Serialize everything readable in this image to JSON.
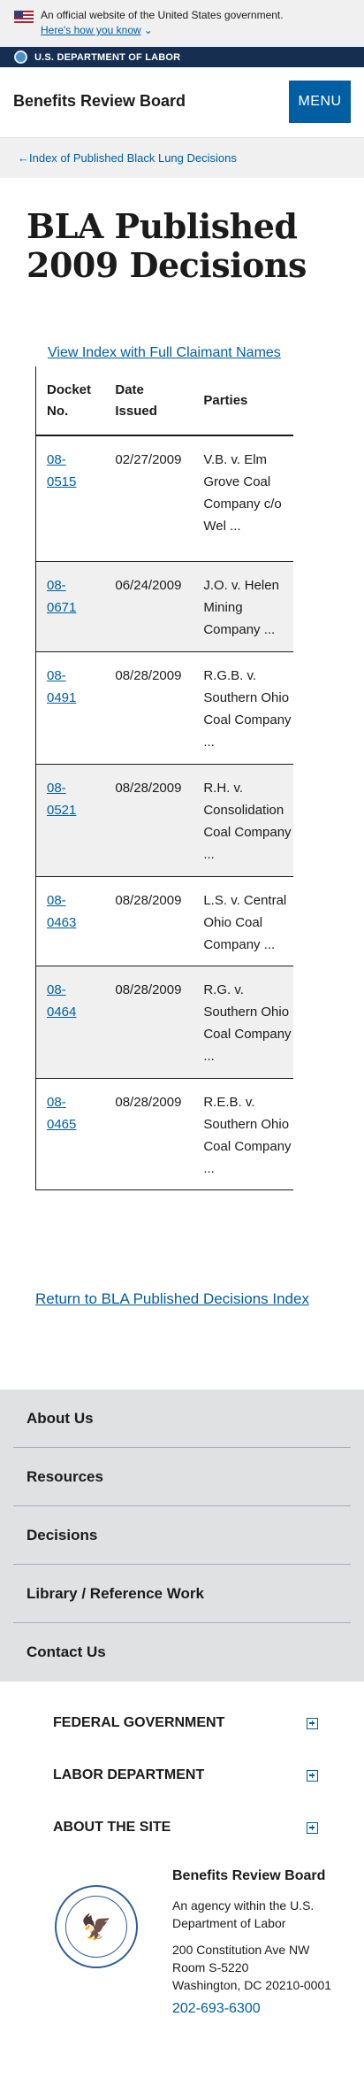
{
  "gov_banner": {
    "text": "An official website of the United States government.",
    "link": "Here's how you know"
  },
  "agency_bar": {
    "label": "U.S. DEPARTMENT OF LABOR"
  },
  "header": {
    "title": "Benefits Review Board",
    "menu_label": "MENU"
  },
  "breadcrumb": {
    "label": "Index of Published Black Lung Decisions"
  },
  "page_title": "BLA Published 2009 Decisions",
  "index_link": "View Index with Full Claimant Names",
  "table": {
    "headers": [
      "Docket No.",
      "Date Issued",
      "Parties"
    ],
    "rows": [
      {
        "docket": "08-0515",
        "date": "02/27/2009",
        "parties": "V.B. v. Elm Grove Coal Company c/o Wel ..."
      },
      {
        "docket": "08-0671",
        "date": "06/24/2009",
        "parties": "J.O. v. Helen Mining Company ..."
      },
      {
        "docket": "08-0491",
        "date": "08/28/2009",
        "parties": "R.G.B. v. Southern Ohio Coal Company ..."
      },
      {
        "docket": "08-0521",
        "date": "08/28/2009",
        "parties": "R.H. v. Consolidation Coal Company ..."
      },
      {
        "docket": "08-0463",
        "date": "08/28/2009",
        "parties": "L.S. v. Central Ohio Coal Company ..."
      },
      {
        "docket": "08-0464",
        "date": "08/28/2009",
        "parties": "R.G. v. Southern Ohio Coal Company ..."
      },
      {
        "docket": "08-0465",
        "date": "08/28/2009",
        "parties": "R.E.B. v. Southern Ohio Coal Company ..."
      }
    ]
  },
  "return_link": "Return to BLA Published Decisions Index",
  "footer_nav": [
    "About Us",
    "Resources",
    "Decisions",
    "Library / Reference Work",
    "Contact Us"
  ],
  "footer_sections": [
    "FEDERAL GOVERNMENT",
    "LABOR DEPARTMENT",
    "ABOUT THE SITE"
  ],
  "footer_agency": {
    "name": "Benefits Review Board",
    "desc1": "An agency within the U.S.",
    "desc2": "Department of Labor",
    "addr1": "200 Constitution Ave NW",
    "addr2": "Room S-5220",
    "addr3": "Washington, DC 20210-0001",
    "phone": "202-693-6300"
  },
  "colors": {
    "accent": "#005ea2",
    "agency_bar": "#162e51",
    "gray_bg": "#f0f0f0",
    "footer_nav_bg": "#dfe1e2"
  },
  "icons": {
    "flag": "us-flag-icon",
    "chevron": "chevron-down-icon",
    "arrow": "arrow-left-icon",
    "plus": "plus-box-icon",
    "seal": "dol-seal-icon"
  }
}
